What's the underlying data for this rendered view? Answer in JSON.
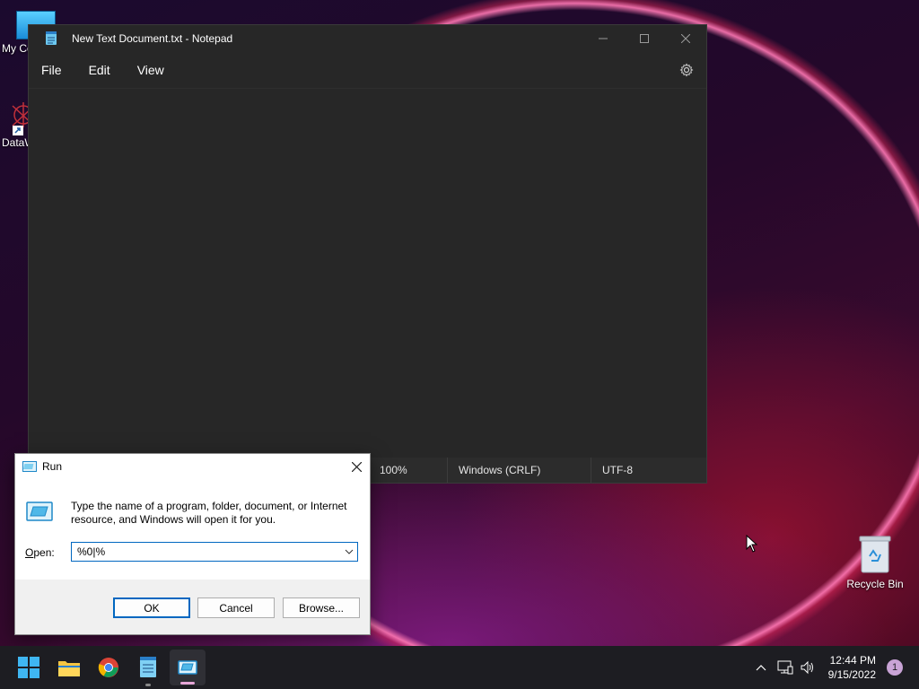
{
  "desktop": {
    "icons": [
      {
        "label": "My Co"
      },
      {
        "label": "DataW"
      },
      {
        "label": "Recycle Bin"
      }
    ]
  },
  "notepad": {
    "title": "New Text Document.txt - Notepad",
    "menu": [
      "File",
      "Edit",
      "View"
    ],
    "status": {
      "zoom": "100%",
      "line_ending": "Windows (CRLF)",
      "encoding": "UTF-8"
    }
  },
  "run_dialog": {
    "title": "Run",
    "description": "Type the name of a program, folder, document, or Internet resource, and Windows will open it for you.",
    "open_label_underlined": "O",
    "open_label_rest": "pen:",
    "input_value": "%0|%",
    "buttons": {
      "ok": "OK",
      "cancel": "Cancel",
      "browse": "Browse..."
    }
  },
  "taskbar": {
    "apps": [
      "start-icon",
      "file-explorer-icon",
      "chrome-icon",
      "notepad-icon",
      "run-icon"
    ],
    "clock": {
      "time": "12:44 PM",
      "date": "9/15/2022"
    },
    "notification_count": "1"
  },
  "colors": {
    "notepad_bg": "#272727",
    "taskbar_bg": "#1d1d22",
    "accent": "#0067c0"
  }
}
